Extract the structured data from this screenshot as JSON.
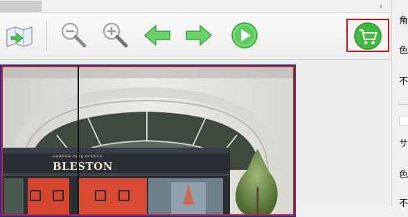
{
  "scrollbar": {
    "arrow_icon": "chevron-right-icon",
    "arrow_glyph": "›"
  },
  "toolbar": {
    "buttons": [
      {
        "icon": "map-export-icon"
      },
      {
        "icon": "zoom-out-icon"
      },
      {
        "icon": "zoom-in-icon"
      },
      {
        "icon": "arrow-left-icon"
      },
      {
        "icon": "arrow-right-icon"
      },
      {
        "icon": "play-icon"
      },
      {
        "icon": "shopping-cart-icon"
      }
    ],
    "accent_green": "#3cbf3c",
    "highlight_border": "#d0101a"
  },
  "right_panel": {
    "labels": [
      "角",
      "色",
      "不",
      "サ",
      "色",
      "不"
    ]
  },
  "image": {
    "sign_small": "HARBOR PARK AVENUE",
    "sign_big": "BLESTON",
    "frame_color": "#1e2fa6",
    "selection_color": "#d42020"
  }
}
